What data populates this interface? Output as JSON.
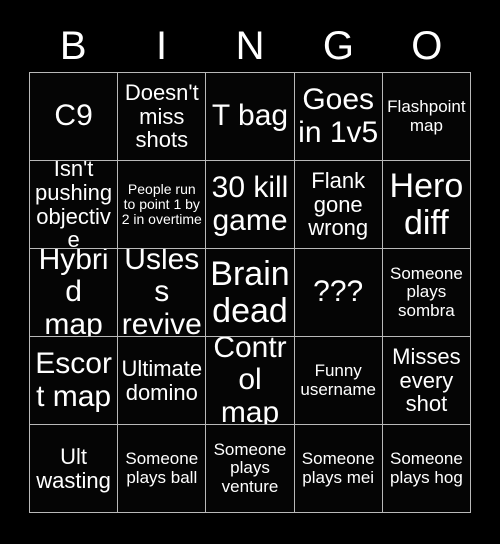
{
  "header": {
    "letters": [
      "B",
      "I",
      "N",
      "G",
      "O"
    ]
  },
  "grid": {
    "rows": 5,
    "columns": 5,
    "border_color": "#b9b9b9",
    "background_color": "#000000",
    "text_color": "#ffffff",
    "cells": [
      {
        "text": "C9",
        "size": "fs-lg"
      },
      {
        "text": "Doesn't miss shots",
        "size": "fs-md"
      },
      {
        "text": "T bag",
        "size": "fs-lg"
      },
      {
        "text": "Goes in 1v5",
        "size": "fs-lg"
      },
      {
        "text": "Flashpoint map",
        "size": "fs-sm"
      },
      {
        "text": "Isn't pushing objective",
        "size": "fs-md"
      },
      {
        "text": "People run to point 1 by 2 in overtime",
        "size": "fs-xs"
      },
      {
        "text": "30 kill game",
        "size": "fs-lg"
      },
      {
        "text": "Flank gone wrong",
        "size": "fs-md"
      },
      {
        "text": "Hero diff",
        "size": "fs-xl"
      },
      {
        "text": "Hybrid map",
        "size": "fs-lg"
      },
      {
        "text": "Usless revive",
        "size": "fs-lg"
      },
      {
        "text": "Brain dead",
        "size": "fs-xl"
      },
      {
        "text": "???",
        "size": "fs-lg"
      },
      {
        "text": "Someone plays sombra",
        "size": "fs-sm"
      },
      {
        "text": "Escort map",
        "size": "fs-lg"
      },
      {
        "text": "Ultimate domino",
        "size": "fs-md"
      },
      {
        "text": "Control map",
        "size": "fs-lg"
      },
      {
        "text": "Funny username",
        "size": "fs-sm"
      },
      {
        "text": "Misses every shot",
        "size": "fs-md"
      },
      {
        "text": "Ult wasting",
        "size": "fs-md"
      },
      {
        "text": "Someone plays ball",
        "size": "fs-sm"
      },
      {
        "text": "Someone plays venture",
        "size": "fs-sm"
      },
      {
        "text": "Someone plays mei",
        "size": "fs-sm"
      },
      {
        "text": "Someone plays hog",
        "size": "fs-sm"
      }
    ]
  }
}
